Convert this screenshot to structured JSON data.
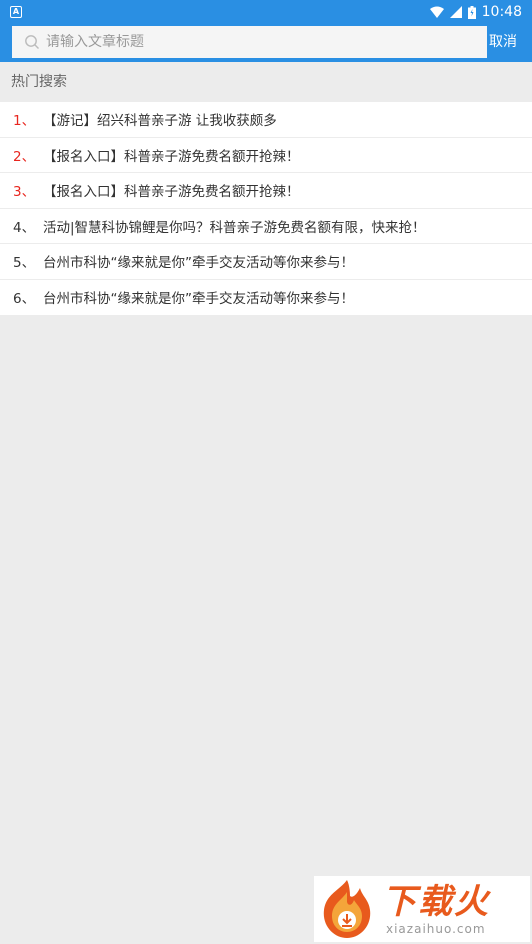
{
  "status_bar": {
    "time": "10:48",
    "badge": "A"
  },
  "search": {
    "placeholder": "请输入文章标题",
    "value": "",
    "cancel_label": "取消"
  },
  "hot_search": {
    "title": "热门搜索",
    "items": [
      {
        "index": "1、",
        "text": "【游记】绍兴科普亲子游 让我收获颇多",
        "hot": true
      },
      {
        "index": "2、",
        "text": "【报名入口】科普亲子游免费名额开抢辣！",
        "hot": true
      },
      {
        "index": "3、",
        "text": "【报名入口】科普亲子游免费名额开抢辣！",
        "hot": true
      },
      {
        "index": "4、",
        "text": "活动|智慧科协锦鲤是你吗？科普亲子游免费名额有限，快来抢！",
        "hot": false
      },
      {
        "index": "5、",
        "text": "台州市科协“缘来就是你”牵手交友活动等你来参与！",
        "hot": false
      },
      {
        "index": "6、",
        "text": "台州市科协“缘来就是你”牵手交友活动等你来参与！",
        "hot": false
      }
    ]
  },
  "watermark": {
    "cn": "下载火",
    "en": "xiazaihuo.com"
  },
  "colors": {
    "primary": "#2a8fe3",
    "hot_index": "#e8261f",
    "logo": "#e85a1d"
  }
}
